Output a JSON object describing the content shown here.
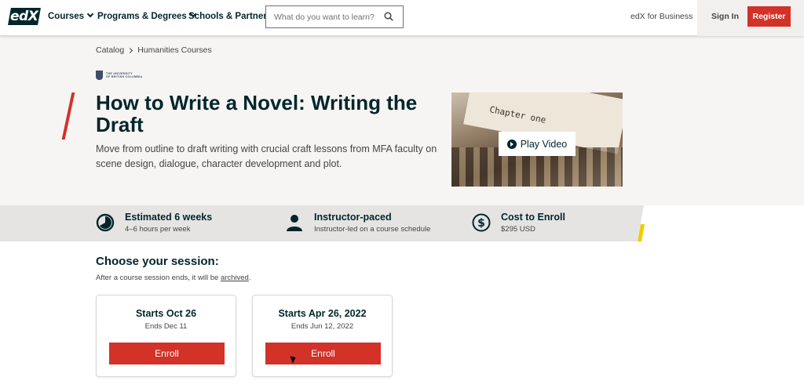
{
  "header": {
    "logo_text": "edX",
    "nav": [
      {
        "label": "Courses",
        "has_menu": true
      },
      {
        "label": "Programs & Degrees",
        "has_menu": true
      },
      {
        "label": "Schools & Partners",
        "has_menu": false
      }
    ],
    "search_placeholder": "What do you want to learn?",
    "business_link": "edX for Business",
    "signin_label": "Sign In",
    "register_label": "Register",
    "accent_color": "#d23228"
  },
  "breadcrumb": [
    "Catalog",
    "Humanities Courses"
  ],
  "institution": {
    "line1": "THE UNIVERSITY",
    "line2": "OF BRITISH COLUMBIA"
  },
  "course": {
    "title": "How to Write a Novel: Writing the Draft",
    "subtitle": "Move from outline to draft writing with crucial craft lessons from MFA faculty on scene design, dialogue, character development and plot.",
    "video_text": "Chapter one",
    "play_label": "Play Video"
  },
  "stats": [
    {
      "icon": "clock-icon",
      "title": "Estimated 6 weeks",
      "sub": "4–6 hours per week"
    },
    {
      "icon": "person-icon",
      "title": "Instructor-paced",
      "sub": "Instructor-led on a course schedule"
    },
    {
      "icon": "dollar-icon",
      "title": "Cost to Enroll",
      "sub": "$295 USD"
    }
  ],
  "session": {
    "heading": "Choose your session:",
    "note_prefix": "After a course session ends, it will be",
    "note_link": "archived",
    "note_suffix": ".",
    "cards": [
      {
        "starts": "Starts Oct 26",
        "ends": "Ends Dec 11",
        "button": "Enroll"
      },
      {
        "starts": "Starts Apr 26, 2022",
        "ends": "Ends Jun 12, 2022",
        "button": "Enroll"
      }
    ]
  }
}
